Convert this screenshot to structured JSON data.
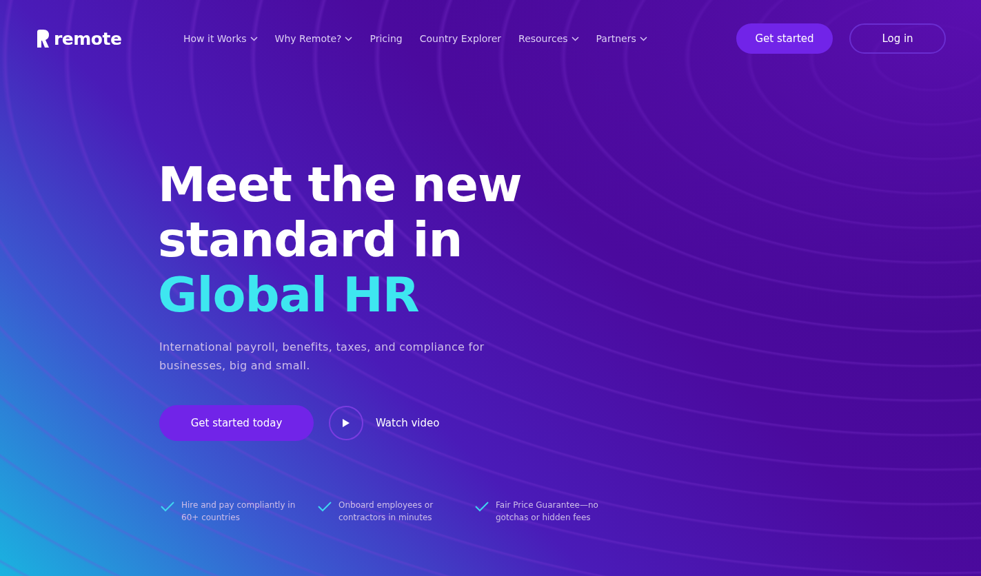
{
  "header": {
    "logo": "remote",
    "nav": [
      {
        "label": "How it Works",
        "has_menu": true
      },
      {
        "label": "Why Remote?",
        "has_menu": true
      },
      {
        "label": "Pricing",
        "has_menu": false
      },
      {
        "label": "Country Explorer",
        "has_menu": false
      },
      {
        "label": "Resources",
        "has_menu": true
      },
      {
        "label": "Partners",
        "has_menu": true
      }
    ],
    "primary_button": "Get started",
    "login_button": "Log in"
  },
  "hero": {
    "headline": [
      {
        "text": "Meet the new",
        "highlight": false
      },
      {
        "text": "standard in",
        "highlight": false
      },
      {
        "text": "Global HR",
        "highlight": true
      }
    ],
    "subtitle": "International payroll, benefits, taxes, and compliance for businesses, big and small.",
    "cta_button": "Get started today",
    "video_link": "Watch video",
    "features": [
      "Hire and pay compliantly in 60+ countries",
      "Onboard employees or contractors in minutes",
      "Fair Price Guarantee—no gotchas or hidden fees"
    ]
  }
}
